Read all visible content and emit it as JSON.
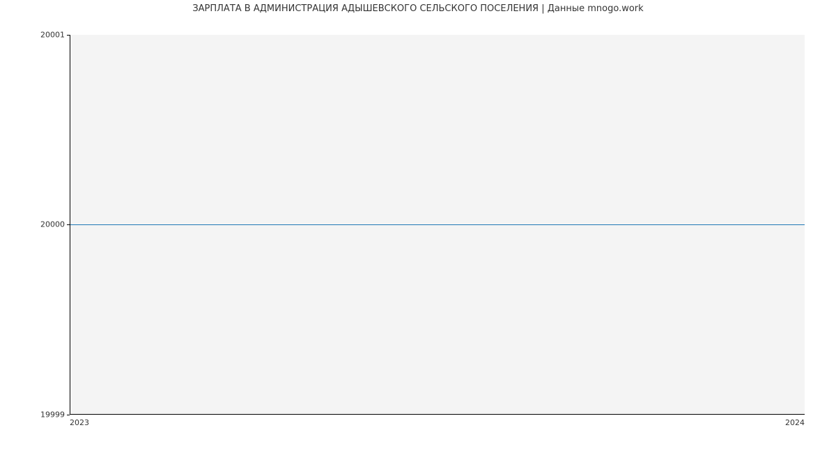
{
  "chart_data": {
    "type": "line",
    "title": "ЗАРПЛАТА В АДМИНИСТРАЦИЯ АДЫШЕВСКОГО СЕЛЬСКОГО ПОСЕЛЕНИЯ | Данные mnogo.work",
    "x": [
      2023,
      2024
    ],
    "series": [
      {
        "name": "salary",
        "values": [
          20000,
          20000
        ],
        "color": "#1f77b4"
      }
    ],
    "xlabel": "",
    "ylabel": "",
    "xlim": [
      2023,
      2024
    ],
    "ylim": [
      19999,
      20001
    ],
    "x_ticks": [
      "2023",
      "2024"
    ],
    "y_ticks": [
      "19999",
      "20000",
      "20001"
    ]
  }
}
